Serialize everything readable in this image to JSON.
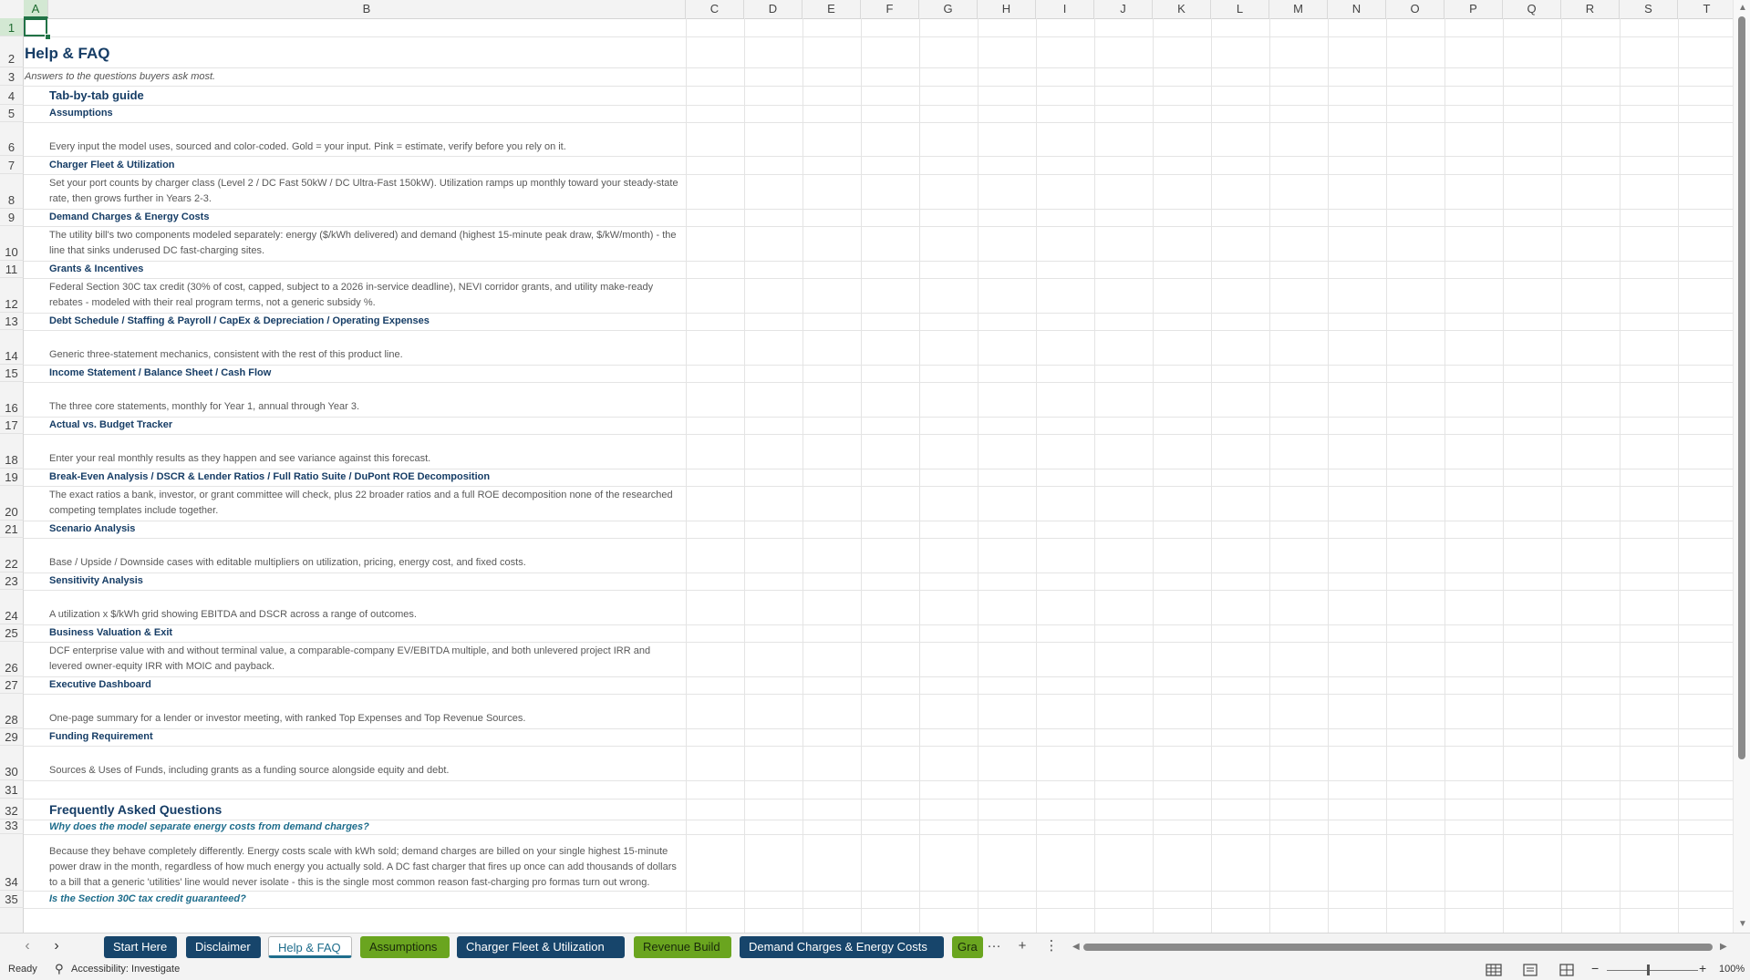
{
  "columns": [
    "A",
    "B",
    "C",
    "D",
    "E",
    "F",
    "G",
    "H",
    "I",
    "J",
    "K",
    "L",
    "M",
    "N",
    "O",
    "P",
    "Q",
    "R",
    "S",
    "T"
  ],
  "rows": [
    "1",
    "2",
    "3",
    "4",
    "5",
    "6",
    "7",
    "8",
    "9",
    "10",
    "11",
    "12",
    "13",
    "14",
    "15",
    "16",
    "17",
    "18",
    "19",
    "20",
    "21",
    "22",
    "23",
    "24",
    "25",
    "26",
    "27",
    "28",
    "29",
    "30",
    "31",
    "32",
    "33",
    "34",
    "35"
  ],
  "sheet": {
    "title": "Help & FAQ",
    "subtitle": "Answers to the questions buyers ask most.",
    "guide_heading": "Tab-by-tab guide",
    "sections": [
      {
        "heading": "Assumptions",
        "text": "Every input the model uses, sourced and color-coded. Gold = your input. Pink = estimate, verify before you rely on it."
      },
      {
        "heading": "Charger Fleet & Utilization",
        "text": "Set your port counts by charger class (Level 2 / DC Fast 50kW / DC Ultra-Fast 150kW). Utilization ramps up monthly toward your steady-state rate, then grows further in Years 2-3."
      },
      {
        "heading": "Demand Charges & Energy Costs",
        "text": "The utility bill's two components modeled separately: energy ($/kWh delivered) and demand (highest 15-minute peak draw, $/kW/month) - the line that sinks underused DC fast-charging sites."
      },
      {
        "heading": "Grants & Incentives",
        "text": "Federal Section 30C tax credit (30% of cost, capped, subject to a 2026 in-service deadline), NEVI corridor grants, and utility make-ready rebates - modeled with their real program terms, not a generic subsidy %."
      },
      {
        "heading": "Debt Schedule / Staffing & Payroll / CapEx & Depreciation / Operating Expenses",
        "text": "Generic three-statement mechanics, consistent with the rest of this product line."
      },
      {
        "heading": "Income Statement / Balance Sheet / Cash Flow",
        "text": "The three core statements, monthly for Year 1, annual through Year 3."
      },
      {
        "heading": "Actual vs. Budget Tracker",
        "text": "Enter your real monthly results as they happen and see variance against this forecast."
      },
      {
        "heading": "Break-Even Analysis / DSCR & Lender Ratios / Full Ratio Suite / DuPont ROE Decomposition",
        "text": "The exact ratios a bank, investor, or grant committee will check, plus 22 broader ratios and a full ROE decomposition none of the researched competing templates include together."
      },
      {
        "heading": "Scenario Analysis",
        "text": "Base / Upside / Downside cases with editable multipliers on utilization, pricing, energy cost, and fixed costs."
      },
      {
        "heading": "Sensitivity Analysis",
        "text": "A utilization x $/kWh grid showing EBITDA and DSCR across a range of outcomes."
      },
      {
        "heading": "Business Valuation & Exit",
        "text": "DCF enterprise value with and without terminal value, a comparable-company EV/EBITDA multiple, and both unlevered project IRR and levered owner-equity IRR with MOIC and payback."
      },
      {
        "heading": "Executive Dashboard",
        "text": "One-page summary for a lender or investor meeting, with ranked Top Expenses and Top Revenue Sources."
      },
      {
        "heading": "Funding Requirement",
        "text": "Sources & Uses of Funds, including grants as a funding source alongside equity and debt."
      }
    ],
    "faq_heading": "Frequently Asked Questions",
    "faq": [
      {
        "question": "Why does the model separate energy costs from demand charges?",
        "answer": "Because they behave completely differently. Energy costs scale with kWh sold; demand charges are billed on your single highest 15-minute power draw in the month, regardless of how much energy you actually sold. A DC fast charger that fires up once can add thousands of dollars to a bill that a generic 'utilities' line would never isolate - this is the single most common reason fast-charging pro formas turn out wrong."
      },
      {
        "question": "Is the Section 30C tax credit guaranteed?",
        "answer": ""
      }
    ]
  },
  "tabs": [
    {
      "label": "Start Here",
      "style": "navy"
    },
    {
      "label": "Disclaimer",
      "style": "navy"
    },
    {
      "label": "Help & FAQ",
      "style": "active"
    },
    {
      "label": "Assumptions",
      "style": "green"
    },
    {
      "label": "Charger Fleet & Utilization",
      "style": "navy"
    },
    {
      "label": "Revenue Build",
      "style": "green"
    },
    {
      "label": "Demand Charges & Energy Costs",
      "style": "navy"
    },
    {
      "label": "Gra",
      "style": "green"
    }
  ],
  "status": {
    "ready": "Ready",
    "accessibility": "Accessibility: Investigate",
    "zoom": "100%"
  },
  "icons": {
    "prev_sheet": "chevron-left-icon",
    "next_sheet": "chevron-right-icon",
    "more_sheets": "ellipsis-icon",
    "add_sheet": "plus-icon",
    "options": "vertical-ellipsis-icon"
  },
  "colors": {
    "navy": "#17456b",
    "green": "#6aa51f",
    "heading": "#163d66",
    "faq": "#1e6d8c",
    "selection": "#217346"
  }
}
